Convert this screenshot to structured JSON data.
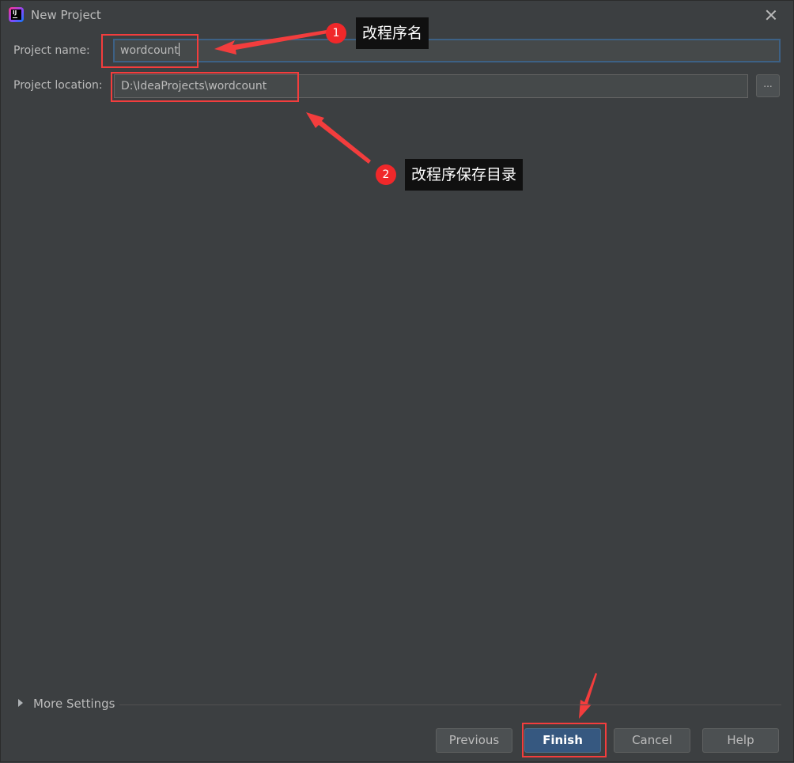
{
  "window": {
    "title": "New Project"
  },
  "form": {
    "name_label": "Project name:",
    "name_value": "wordcount",
    "location_label": "Project location:",
    "location_value": "D:\\IdeaProjects\\wordcount",
    "browse_label": "..."
  },
  "annotations": [
    {
      "number": "1",
      "text": "改程序名"
    },
    {
      "number": "2",
      "text": "改程序保存目录"
    }
  ],
  "more_settings": {
    "label": "More Settings"
  },
  "buttons": {
    "previous": "Previous",
    "finish": "Finish",
    "cancel": "Cancel",
    "help": "Help"
  },
  "colors": {
    "annotation_red": "#f33d3d",
    "primary_button": "#365880",
    "background": "#3c3f41"
  }
}
